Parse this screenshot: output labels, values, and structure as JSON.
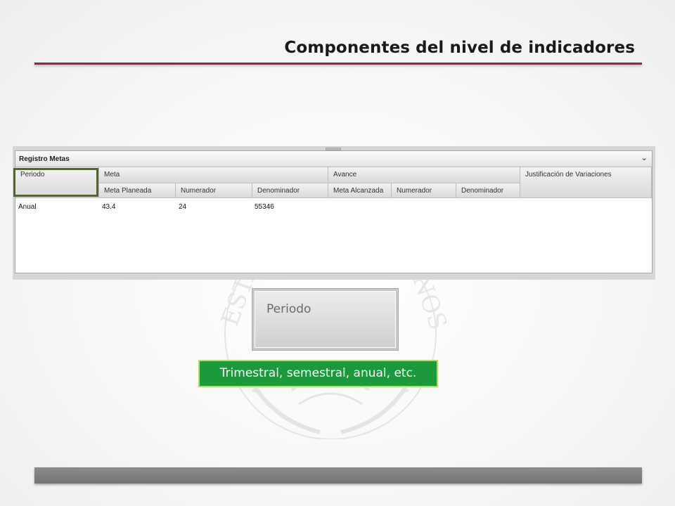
{
  "slide": {
    "title": "Componentes del nivel de indicadores",
    "accent_color": "#9b2243",
    "footer_color": "#7f7f7f"
  },
  "panel": {
    "title": "Registro Metas",
    "collapse_icon": "chevron-down-icon",
    "group_headers": {
      "periodo": "Periodo",
      "meta": "Meta",
      "avance": "Avance",
      "justificacion": "Justificación de Variaciones"
    },
    "sub_headers": {
      "meta_planeada": "Meta Planeada",
      "meta_numerador": "Numerador",
      "meta_denominador": "Denominador",
      "meta_alcanzada": "Meta Alcanzada",
      "avance_numerador": "Numerador",
      "avance_denominador": "Denominador"
    },
    "rows": [
      {
        "periodo": "Anual",
        "meta_planeada": "43.4",
        "numerador": "24",
        "denominador": "55346"
      }
    ]
  },
  "zoom": {
    "label": "Periodo"
  },
  "callout": {
    "text": "Trimestral, semestral, anual, etc.",
    "color": "#1a9a3a"
  },
  "seal": {
    "lettering_left": "ESTA",
    "lettering_right": "NOS"
  }
}
